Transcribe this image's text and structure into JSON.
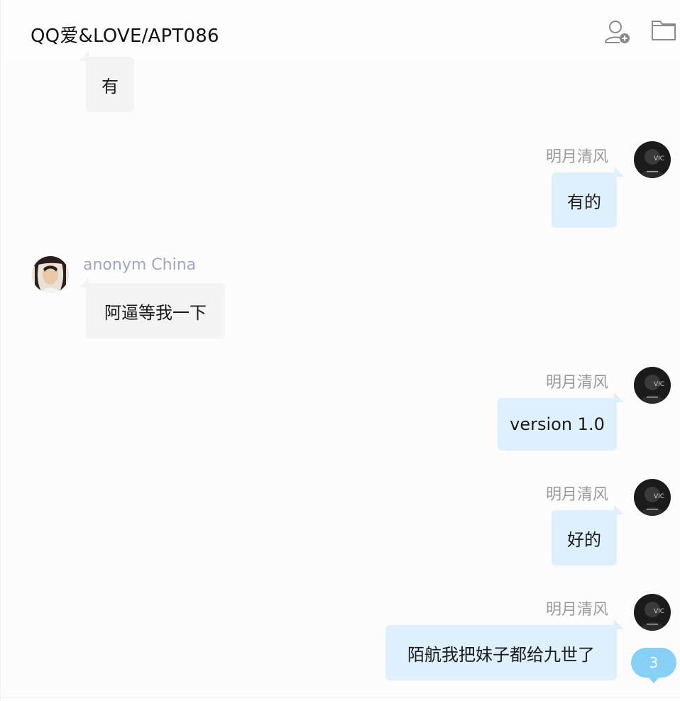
{
  "header": {
    "title": "QQ爱&LOVE/APT086",
    "icons": [
      "add-user-icon",
      "folder-icon"
    ]
  },
  "messages": [
    {
      "side": "theirs",
      "sender": "",
      "text": "有"
    },
    {
      "side": "mine",
      "sender": "明月清风",
      "text": "有的"
    },
    {
      "side": "theirs",
      "sender": "anonym China",
      "text": "阿逼等我一下"
    },
    {
      "side": "mine",
      "sender": "明月清风",
      "text": "version 1.0"
    },
    {
      "side": "mine",
      "sender": "明月清风",
      "text": "好的"
    },
    {
      "side": "mine",
      "sender": "明月清风",
      "text": "陌航我把妹子都给九世了"
    }
  ],
  "unread_badge": {
    "count": "3"
  },
  "colors": {
    "mine_bubble": "#dff0fd",
    "theirs_bubble": "#f3f3f4",
    "badge": "#86d0f5",
    "other_sender": "#9fa6c2",
    "self_sender": "#9a9a9a"
  }
}
